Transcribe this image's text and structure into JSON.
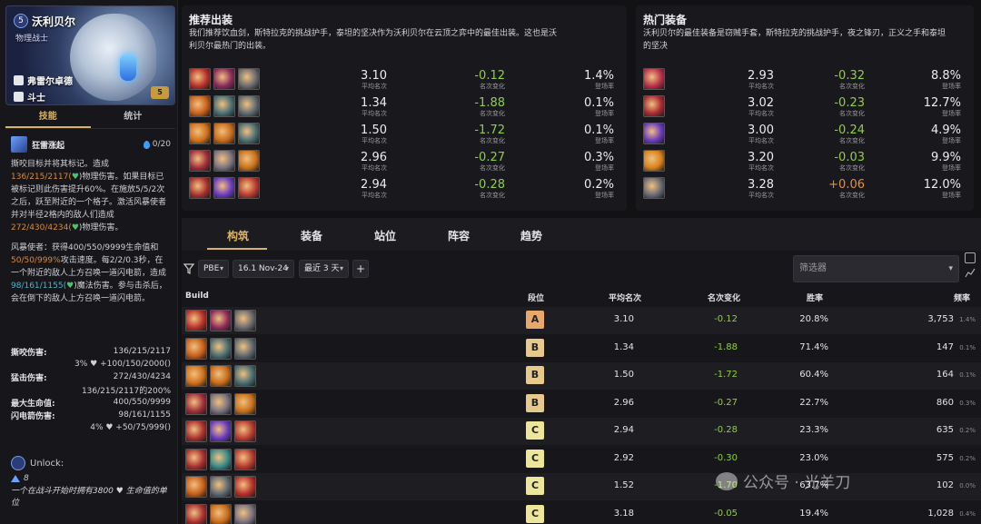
{
  "champion": {
    "name": "沃利贝尔",
    "role": "物理战士",
    "cost": "5",
    "level_tag": "5",
    "traits": [
      "弗雷尔卓德",
      "斗士"
    ]
  },
  "left_tabs": [
    "技能",
    "统计"
  ],
  "ability": {
    "name": "狂雷涨起",
    "mana": "0/20",
    "desc_parts": [
      "撕咬目标并将其标记。造成",
      "136/215/2117",
      "(",
      ")物理伤害。如果目标已被标记则此伤害提升60%。在施放5/5/2次之后，跃至附近的一个格子。激活风暴使者并对半径2格内的敌人们造成",
      "272/430/4234",
      "(",
      ")物理伤害。"
    ],
    "desc2_parts": [
      "风暴使者：获得400/550/9999生命值和",
      "50/50/999%",
      "攻击速度。每2/2/0.3秒，在一个附近的敌人上方召唤一道闪电箭，造成",
      "98/161/1155",
      "(",
      ")魔法伤害。参与击杀后，会在倒下的敌人上方召唤一道闪电箭。"
    ]
  },
  "stats": [
    {
      "k": "撕咬伤害:",
      "v": "136/215/2117"
    },
    {
      "k": "",
      "v": "3% ♥ +100/150/2000()"
    },
    {
      "k": "猛击伤害:",
      "v": "272/430/4234"
    },
    {
      "k": "",
      "v": "136/215/2117的200%"
    },
    {
      "k": "最大生命值:",
      "v": "400/550/9999"
    },
    {
      "k": "闪电箭伤害:",
      "v": "98/161/1155"
    },
    {
      "k": "",
      "v": "4% ♥ +50/75/999()"
    }
  ],
  "unlock": {
    "label": "Unlock:",
    "value": "8",
    "desc": "一个在战斗开始时拥有3800 ♥ 生命值的单位"
  },
  "recommended": {
    "title": "推荐出装",
    "desc": "我们推荐饮血剑，斯特拉克的挑战护手，泰坦的坚决作为沃利贝尔在云顶之弈中的最佳出装。这也是沃利贝尔最热门的出装。",
    "rows": [
      {
        "avg": "3.10",
        "avg_label": "平均名次",
        "change": "-0.12",
        "change_label": "名次变化",
        "rate": "1.4%",
        "rate_label": "登场率"
      },
      {
        "avg": "1.34",
        "avg_label": "平均名次",
        "change": "-1.88",
        "change_label": "名次变化",
        "rate": "0.1%",
        "rate_label": "登场率"
      },
      {
        "avg": "1.50",
        "avg_label": "平均名次",
        "change": "-1.72",
        "change_label": "名次变化",
        "rate": "0.1%",
        "rate_label": "登场率"
      },
      {
        "avg": "2.96",
        "avg_label": "平均名次",
        "change": "-0.27",
        "change_label": "名次变化",
        "rate": "0.3%",
        "rate_label": "登场率"
      },
      {
        "avg": "2.94",
        "avg_label": "平均名次",
        "change": "-0.28",
        "change_label": "名次变化",
        "rate": "0.2%",
        "rate_label": "登场率"
      }
    ]
  },
  "hot_items": {
    "title": "热门装备",
    "desc": "沃利贝尔的最佳装备是窃贼手套，斯特拉克的挑战护手，夜之锋刃，正义之手和泰坦的坚决",
    "rows": [
      {
        "avg": "2.93",
        "avg_label": "平均名次",
        "change": "-0.32",
        "change_label": "名次变化",
        "rate": "8.8%",
        "rate_label": "登场率"
      },
      {
        "avg": "3.02",
        "avg_label": "平均名次",
        "change": "-0.23",
        "change_label": "名次变化",
        "rate": "12.7%",
        "rate_label": "登场率"
      },
      {
        "avg": "3.00",
        "avg_label": "平均名次",
        "change": "-0.24",
        "change_label": "名次变化",
        "rate": "4.9%",
        "rate_label": "登场率"
      },
      {
        "avg": "3.20",
        "avg_label": "平均名次",
        "change": "-0.03",
        "change_label": "名次变化",
        "rate": "9.9%",
        "rate_label": "登场率"
      },
      {
        "avg": "3.28",
        "avg_label": "平均名次",
        "change": "+0.06",
        "change_label": "名次变化",
        "rate": "12.0%",
        "rate_label": "登场率"
      }
    ]
  },
  "main_tabs": [
    "构筑",
    "装备",
    "站位",
    "阵容",
    "趋势"
  ],
  "filters": {
    "server": "PBE",
    "patch": "16.1 Nov-24",
    "period": "最近 3 天",
    "plus": "+",
    "search_placeholder": "筛选器"
  },
  "table": {
    "headers": [
      "Build",
      "段位",
      "平均名次",
      "名次变化",
      "胜率",
      "频率"
    ],
    "rows": [
      {
        "tier": "A",
        "avg": "3.10",
        "change": "-0.12",
        "win": "20.8%",
        "count": "3,753",
        "freq": "1.4%"
      },
      {
        "tier": "B",
        "avg": "1.34",
        "change": "-1.88",
        "win": "71.4%",
        "count": "147",
        "freq": "0.1%"
      },
      {
        "tier": "B",
        "avg": "1.50",
        "change": "-1.72",
        "win": "60.4%",
        "count": "164",
        "freq": "0.1%"
      },
      {
        "tier": "B",
        "avg": "2.96",
        "change": "-0.27",
        "win": "22.7%",
        "count": "860",
        "freq": "0.3%"
      },
      {
        "tier": "C",
        "avg": "2.94",
        "change": "-0.28",
        "win": "23.3%",
        "count": "635",
        "freq": "0.2%"
      },
      {
        "tier": "C",
        "avg": "2.92",
        "change": "-0.30",
        "win": "23.0%",
        "count": "575",
        "freq": "0.2%"
      },
      {
        "tier": "C",
        "avg": "1.52",
        "change": "-1.70",
        "win": "63.7%",
        "count": "102",
        "freq": "0.0%"
      },
      {
        "tier": "C",
        "avg": "3.18",
        "change": "-0.05",
        "win": "19.4%",
        "count": "1,028",
        "freq": "0.4%"
      }
    ]
  },
  "watermark": "公众号 · 光羊刀",
  "colors": {
    "tierA": "#e8a86a",
    "tierB": "#e7c98c",
    "tierC": "#ece59a",
    "gold": "#d8b36a"
  }
}
